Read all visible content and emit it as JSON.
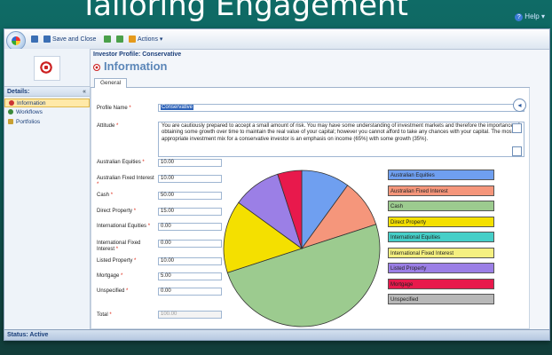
{
  "background_title": "Tailoring Engagement",
  "help_label": "Help",
  "toolbar": {
    "save_close_label": "Save and Close",
    "actions_label": "Actions"
  },
  "sidebar": {
    "details_label": "Details:",
    "items": [
      {
        "label": "Information",
        "selected": true
      },
      {
        "label": "Workflows",
        "selected": false
      },
      {
        "label": "Portfolios",
        "selected": false
      }
    ]
  },
  "header": {
    "breadcrumb": "Investor Profile: Conservative",
    "title": "Information"
  },
  "tabs": [
    {
      "label": "General"
    }
  ],
  "form": {
    "profile_name_label": "Profile Name",
    "profile_name_value": "Conservative",
    "attitude_label": "Attitude",
    "attitude_value": "You are cautiously prepared to accept a small amount of risk. You may have some understanding of investment markets and therefore the importance of obtaining some growth over time to maintain the real value of your capital; however you cannot afford to take any chances with your capital. The most appropriate investment mix for a conservative investor is an emphasis on income (65%) with some growth (35%).",
    "allocations": [
      {
        "label": "Australian Equities",
        "value": "10.00",
        "color": "#6f9ff0"
      },
      {
        "label": "Australian Fixed Interest",
        "value": "10.00",
        "color": "#f5967b"
      },
      {
        "label": "Cash",
        "value": "50.00",
        "color": "#9ccb8f"
      },
      {
        "label": "Direct Property",
        "value": "15.00",
        "color": "#f4e000"
      },
      {
        "label": "International Equities",
        "value": "0.00",
        "color": "#46cfc8"
      },
      {
        "label": "International Fixed Interest",
        "value": "0.00",
        "color": "#f5f080"
      },
      {
        "label": "Listed Property",
        "value": "10.00",
        "color": "#9b7fe6"
      },
      {
        "label": "Mortgage",
        "value": "5.00",
        "color": "#e8194c"
      },
      {
        "label": "Unspecified",
        "value": "0.00",
        "color": "#b8b8b8"
      }
    ],
    "total_label": "Total",
    "total_value": "100.00"
  },
  "chart_data": {
    "type": "pie",
    "categories": [
      "Australian Equities",
      "Australian Fixed Interest",
      "Cash",
      "Direct Property",
      "International Equities",
      "International Fixed Interest",
      "Listed Property",
      "Mortgage",
      "Unspecified"
    ],
    "values": [
      10,
      10,
      50,
      15,
      0,
      0,
      10,
      5,
      0
    ],
    "legend_position": "right"
  },
  "status_bar": "Status: Active"
}
